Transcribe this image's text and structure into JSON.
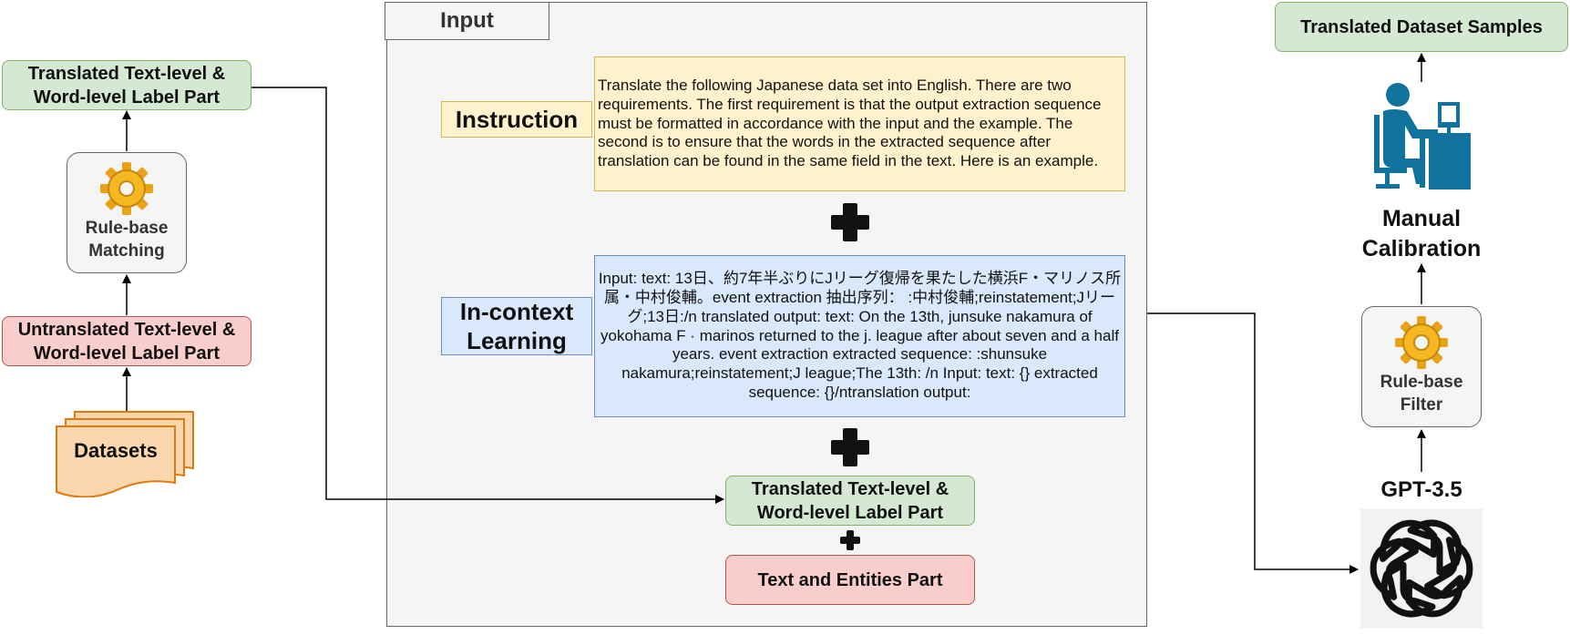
{
  "left": {
    "translated_label_part": "Translated Text-level & Word-level Label Part",
    "rule_matching": "Rule-base Matching",
    "untranslated_label_part": "Untranslated Text-level & Word-level Label Part",
    "datasets": "Datasets"
  },
  "input_panel": {
    "title": "Input",
    "instruction_label": "Instruction",
    "instruction_text": "Translate the following Japanese data set into English. There are two requirements. The first requirement is that the output extraction sequence must be formatted in accordance with the input and the example. The second is to ensure that the words in the extracted sequence after translation can be found in the same field in the text. Here is an example.",
    "icl_label": "In-context Learning",
    "icl_text": "Input: text: 13日、約7年半ぶりにJリーグ復帰を果たした横浜F・マリノス所属・中村俊輔。event extraction 抽出序列： :中村俊輔;reinstatement;Jリーグ;13日:/n translated output: text: On the 13th, junsuke nakamura of yokohama F · marinos returned to the j. league after about seven and a half years. event extraction extracted sequence: :shunsuke nakamura;reinstatement;J league;The 13th: /n Input: text: {} extracted sequence: {}/ntranslation output:",
    "translated_label_part": "Translated Text-level & Word-level Label Part",
    "text_entities_part": "Text and Entities Part"
  },
  "right": {
    "output_samples": "Translated Dataset Samples",
    "manual_calibration": "Manual Calibration",
    "rule_filter": "Rule-base Filter",
    "model_label": "GPT-3.5"
  },
  "colors": {
    "green_fill": "#d5e8d4",
    "green_stroke": "#82b366",
    "red_fill": "#f8cecc",
    "red_stroke": "#b85450",
    "yellow_fill": "#fff2cc",
    "yellow_stroke": "#d6b656",
    "blue_fill": "#dae8fc",
    "blue_stroke": "#6c8ebf",
    "orange_fill": "#fad7ac",
    "orange_stroke": "#e07a10",
    "person_icon": "#10739e"
  },
  "icons": [
    "gear-icon",
    "person-at-computer-icon",
    "openai-logo-icon",
    "document-stack-icon",
    "plus-icon"
  ]
}
